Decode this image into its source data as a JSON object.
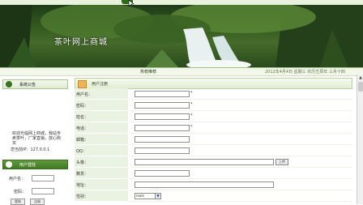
{
  "banner": {
    "title": "茶叶网上商城"
  },
  "nav": {
    "center_text": "热荐推荐",
    "date": "2012年4月4日 星期三 农历壬辰年 三月十四"
  },
  "left": {
    "notice_title": "系统公告",
    "notice_text": "欢迎光临网上商城，我站专卖茶叶，厂家直销，放心购买",
    "visitor": "您当前IP：127.0.0.1",
    "login_title": "用户登陆",
    "username_label": "用户名：",
    "password_label": "密码：",
    "login_button": "登陆",
    "register_button": "注册"
  },
  "main": {
    "title": "用户注册",
    "fields": [
      {
        "label": "用户名：",
        "required": "*"
      },
      {
        "label": "密码：",
        "required": "*"
      },
      {
        "label": "姓名：",
        "required": "*"
      },
      {
        "label": "电话：",
        "required": "*"
      },
      {
        "label": "邮箱：",
        "required": ""
      },
      {
        "label": "QQ：",
        "required": ""
      },
      {
        "label": "头像：",
        "required": ""
      },
      {
        "label": "籍贯：",
        "required": ""
      },
      {
        "label": "地址：",
        "required": ""
      },
      {
        "label": "性别：",
        "required": ""
      }
    ],
    "upload_button": "上传",
    "gender_value": "male"
  },
  "colors": {
    "accent": "#3d6e26",
    "label_bg": "#eaf2e2",
    "banner": "#34591f"
  }
}
